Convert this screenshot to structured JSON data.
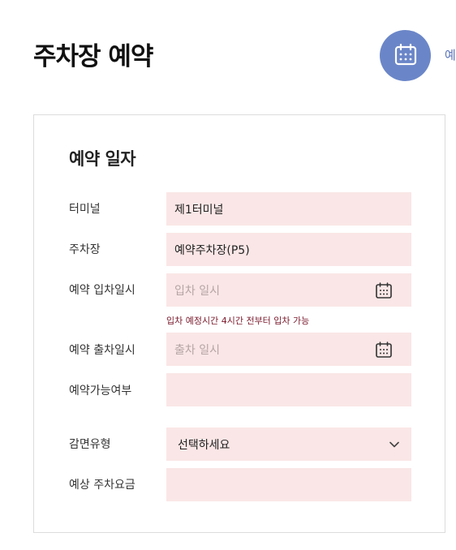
{
  "header": {
    "title": "주차장 예약",
    "step_label": "예",
    "step_icon": "calendar-icon",
    "accent_color": "#6b86c8"
  },
  "form": {
    "section_title": "예약 일자",
    "terminal": {
      "label": "터미널",
      "value": "제1터미널"
    },
    "parking": {
      "label": "주차장",
      "value": "예약주차장(P5)"
    },
    "entry": {
      "label": "예약 입차일시",
      "placeholder": "입차 일시",
      "icon": "calendar-icon"
    },
    "entry_notice": "입차 예정시간 4시간 전부터 입차 가능",
    "exit": {
      "label": "예약 출차일시",
      "placeholder": "출차 일시",
      "icon": "calendar-icon"
    },
    "availability": {
      "label": "예약가능여부",
      "value": ""
    },
    "discount": {
      "label": "감면유형",
      "selected": "선택하세요",
      "icon": "chevron-down-icon"
    },
    "fee": {
      "label": "예상 주차요금",
      "value": ""
    }
  },
  "colors": {
    "field_background": "#fae6e6",
    "notice_text": "#7a1a2c",
    "placeholder_text": "#b5a4a4"
  }
}
